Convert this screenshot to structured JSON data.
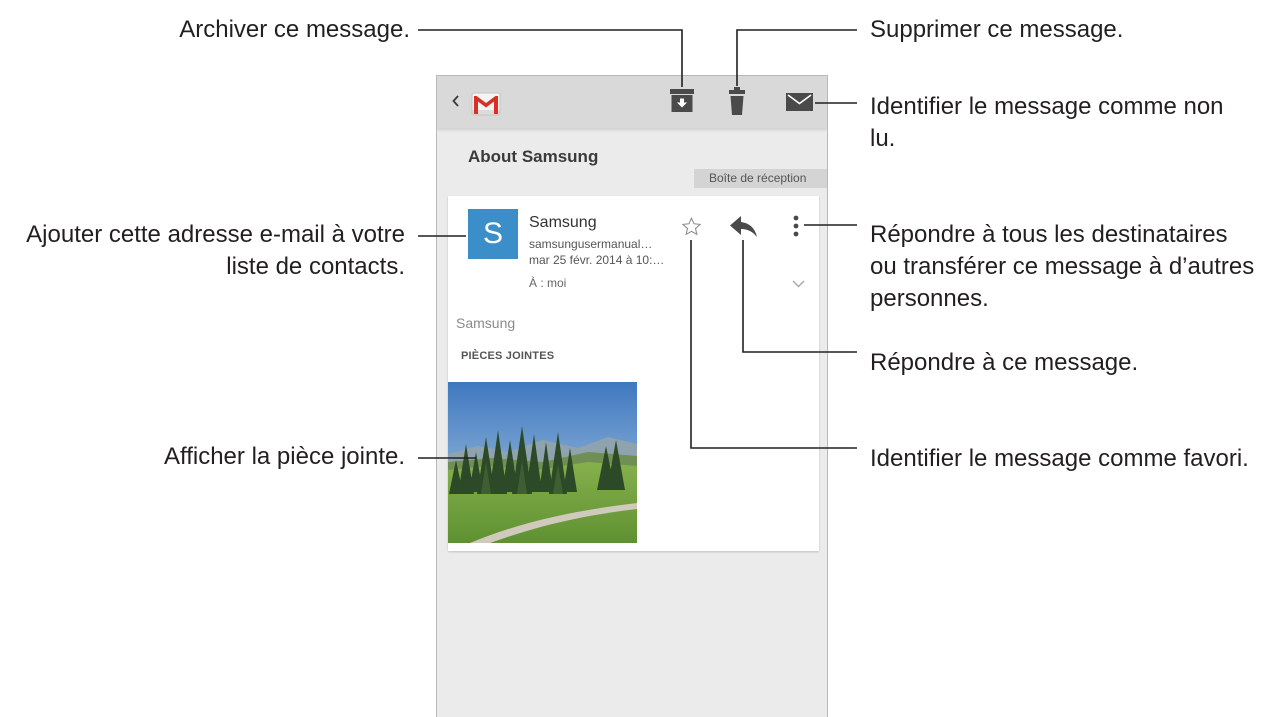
{
  "callouts": {
    "archive": {
      "lines": [
        "Archiver ce message."
      ]
    },
    "delete": {
      "lines": [
        "Supprimer ce message."
      ]
    },
    "mark_unread": {
      "lines": [
        "Identifier le message comme non",
        "lu."
      ]
    },
    "add_contact": {
      "lines": [
        "Ajouter cette adresse e-mail à votre",
        "liste de contacts."
      ]
    },
    "more_options": {
      "lines": [
        "Répondre à tous les destinataires",
        "ou transférer ce message à d’autres",
        "personnes."
      ]
    },
    "reply": {
      "lines": [
        "Répondre à ce message."
      ]
    },
    "star": {
      "lines": [
        "Identifier le message comme favori."
      ]
    },
    "attachment": {
      "lines": [
        "Afficher la pièce jointe."
      ]
    }
  },
  "app": {
    "action_bar": {
      "icons": [
        "back-chevron-icon",
        "gmail-icon",
        "archive-icon",
        "delete-icon",
        "mark-unread-icon"
      ]
    },
    "conversation": {
      "subject": "About Samsung",
      "folder_label": "Boîte de réception"
    },
    "message": {
      "avatar_letter": "S",
      "sender": "Samsung",
      "sender_email": "samsungusermanual…",
      "date": "mar 25 févr. 2014 à 10:…",
      "recipients": "À : moi",
      "header_icons": [
        "star-icon",
        "reply-icon",
        "more-options-icon",
        "expand-chevron-icon"
      ],
      "body": "Samsung",
      "attachments_heading": "PIÈCES JOINTES"
    }
  },
  "colors": {
    "action_bar_bg": "#d9d9d9",
    "content_bg": "#ebebeb",
    "avatar_bg": "#3b8ec7",
    "gmail_red": "#d93025",
    "icon_gray": "#4a4a4a",
    "callout_text": "#231f20"
  }
}
